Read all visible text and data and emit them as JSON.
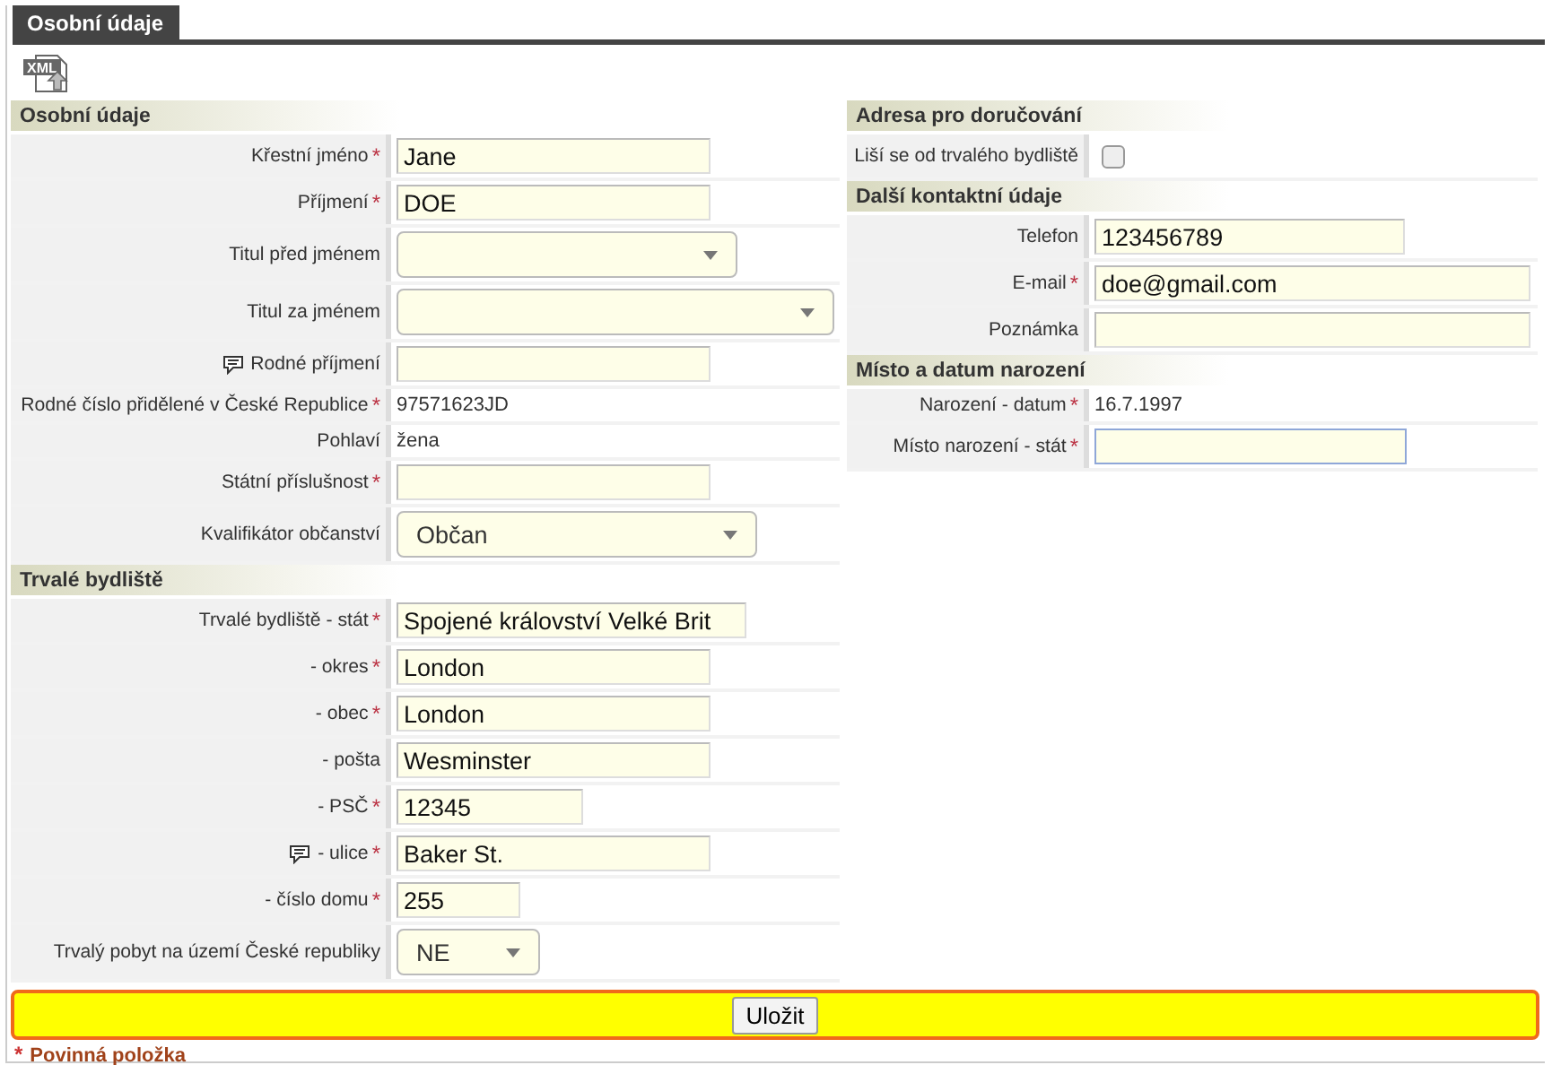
{
  "tab": {
    "label": "Osobní údaje",
    "selected": true
  },
  "export_icon_label": "XML",
  "left_sections": [
    {
      "title": "Osobní údaje",
      "rows": [
        {
          "kind": "input",
          "label": "Křestní jméno",
          "required_mark": "*",
          "value": "Jane"
        },
        {
          "kind": "input",
          "label": "Příjmení",
          "required_mark": "*",
          "value": "DOE"
        },
        {
          "kind": "select",
          "label": "Titul před jménem"
        },
        {
          "kind": "select",
          "label": "Titul za jménem"
        },
        {
          "kind": "input",
          "label": "Rodné příjmení",
          "note": true
        },
        {
          "kind": "text",
          "label": "Rodné číslo přidělené v České Republice",
          "required_mark": "*",
          "value": "97571623JD"
        },
        {
          "kind": "text",
          "label": "Pohlaví",
          "value": "žena"
        },
        {
          "kind": "input",
          "label": "Státní příslušnost",
          "required_mark": "*"
        },
        {
          "kind": "select",
          "label": "Kvalifikátor občanství",
          "value": "Občan"
        }
      ]
    },
    {
      "title": "Trvalé bydliště",
      "rows": [
        {
          "kind": "input",
          "label": "Trvalé bydliště - stát",
          "required_mark": "*",
          "value": "Spojené království Velké Brit"
        },
        {
          "kind": "input",
          "label": "- okres",
          "required_mark": "*",
          "value": "London"
        },
        {
          "kind": "input",
          "label": "- obec",
          "required_mark": "*",
          "value": "London"
        },
        {
          "kind": "input",
          "label": "- pošta",
          "value": "Wesminster"
        },
        {
          "kind": "input",
          "label": "- PSČ",
          "required_mark": "*",
          "value": "12345"
        },
        {
          "kind": "input",
          "label": "- ulice",
          "required_mark": "*",
          "note": true,
          "value": "Baker St."
        },
        {
          "kind": "input",
          "label": "- číslo domu",
          "required_mark": "*",
          "value": "255"
        },
        {
          "kind": "select",
          "label": "Trvalý pobyt na území České republiky",
          "value": "NE"
        }
      ]
    }
  ],
  "right_sections": [
    {
      "title": "Adresa pro doručování",
      "rows": [
        {
          "kind": "checkbox",
          "label": "Liší se od trvalého bydliště",
          "checked": false
        }
      ]
    },
    {
      "title": "Další kontaktní údaje",
      "rows": [
        {
          "kind": "input",
          "label": "Telefon",
          "value": "123456789"
        },
        {
          "kind": "input",
          "label": "E-mail",
          "required_mark": "*",
          "value": "doe@gmail.com"
        },
        {
          "kind": "input",
          "label": "Poznámka"
        }
      ]
    },
    {
      "title": "Místo a datum narození",
      "rows": [
        {
          "kind": "text",
          "label": "Narození - datum",
          "required_mark": "*",
          "value": "16.7.1997"
        },
        {
          "kind": "input",
          "label": "Místo narození - stát",
          "required_mark": "*",
          "focused": true
        }
      ]
    }
  ],
  "save_button": "Uložit",
  "legend": {
    "mark": "*",
    "text": "Povinná položka"
  }
}
